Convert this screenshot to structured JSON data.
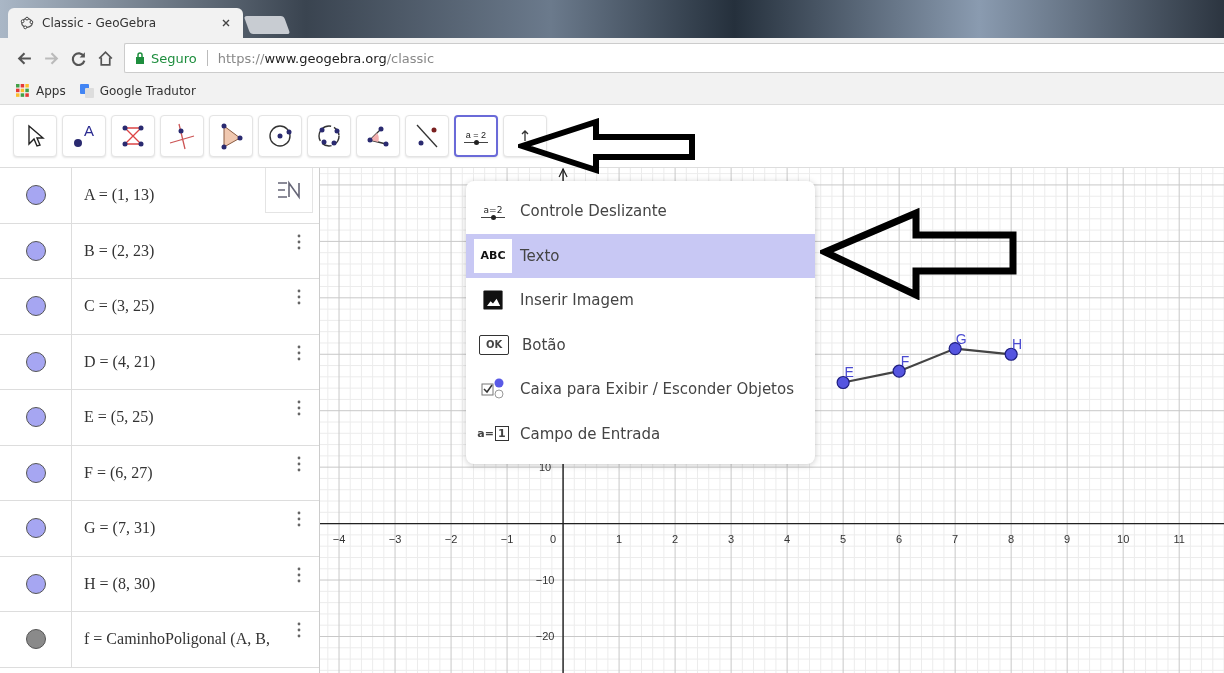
{
  "browser": {
    "tab": {
      "title": "Classic - GeoGebra"
    },
    "address": {
      "security": "Seguro",
      "url_scheme": "https://",
      "url_host": "www.geogebra.org",
      "url_path": "/classic"
    },
    "bookmarks": [
      {
        "kind": "apps",
        "label": "Apps"
      },
      {
        "kind": "translate",
        "label": "Google Tradutor"
      }
    ]
  },
  "toolbar": {
    "tools": [
      {
        "kind": "move",
        "selected": false
      },
      {
        "kind": "point",
        "icon_text": "A",
        "selected": false
      },
      {
        "kind": "segments",
        "selected": false
      },
      {
        "kind": "perpendicular",
        "selected": false
      },
      {
        "kind": "polygon",
        "selected": false
      },
      {
        "kind": "circle",
        "selected": false
      },
      {
        "kind": "conic",
        "selected": false
      },
      {
        "kind": "angle",
        "selected": false
      },
      {
        "kind": "reflect",
        "selected": false
      },
      {
        "kind": "slider",
        "icon_text": "a = 2",
        "selected": true
      },
      {
        "kind": "move-graphics",
        "selected": false
      }
    ]
  },
  "algebra": {
    "items": [
      {
        "text": "A = (1, 13)",
        "color": "#a6a6f2"
      },
      {
        "text": "B = (2, 23)",
        "color": "#a6a6f2"
      },
      {
        "text": "C = (3, 25)",
        "color": "#a6a6f2"
      },
      {
        "text": "D = (4, 21)",
        "color": "#a6a6f2"
      },
      {
        "text": "E = (5, 25)",
        "color": "#a6a6f2"
      },
      {
        "text": "F = (6, 27)",
        "color": "#a6a6f2"
      },
      {
        "text": "G = (7, 31)",
        "color": "#a6a6f2"
      },
      {
        "text": "H = (8, 30)",
        "color": "#a6a6f2"
      },
      {
        "text": "f = CaminhoPoligonal (A, B,",
        "color": "#8a8a8a"
      }
    ]
  },
  "tool_menu": {
    "items": [
      {
        "kind": "slider",
        "icon_text": "a=2",
        "label": "Controle Deslizante",
        "selected": false
      },
      {
        "kind": "text",
        "icon_text": "ABC",
        "label": "Texto",
        "selected": true
      },
      {
        "kind": "image",
        "label": "Inserir Imagem",
        "selected": false
      },
      {
        "kind": "button",
        "icon_text": "OK",
        "label": "Botão",
        "selected": false
      },
      {
        "kind": "checkbox",
        "label": "Caixa para Exibir / Esconder Objetos",
        "selected": false
      },
      {
        "kind": "input",
        "icon_text": "a=",
        "icon_value": "1",
        "label": "Campo de Entrada",
        "selected": false
      }
    ]
  },
  "graphics": {
    "origin_label": "0",
    "chart_data": {
      "type": "line",
      "x": [
        5,
        6,
        7,
        8
      ],
      "series": [
        {
          "color": "#5555e0",
          "marker": "circle",
          "values": [
            25,
            27,
            31,
            30
          ]
        }
      ],
      "grid": true,
      "xlim": [
        -4.34,
        11.8
      ],
      "ylim": [
        -27,
        63
      ],
      "xticks": [
        -4,
        -3,
        -2,
        -1,
        1,
        2,
        3,
        4,
        5,
        6,
        7,
        8,
        9,
        10,
        11
      ],
      "yticks": [
        10,
        -10,
        -20
      ],
      "annotations": [
        {
          "x": 5,
          "y": 25,
          "text": "E"
        },
        {
          "x": 6,
          "y": 27,
          "text": "F"
        },
        {
          "x": 7,
          "y": 31,
          "text": "G"
        },
        {
          "x": 8,
          "y": 30,
          "text": "H"
        }
      ]
    }
  }
}
